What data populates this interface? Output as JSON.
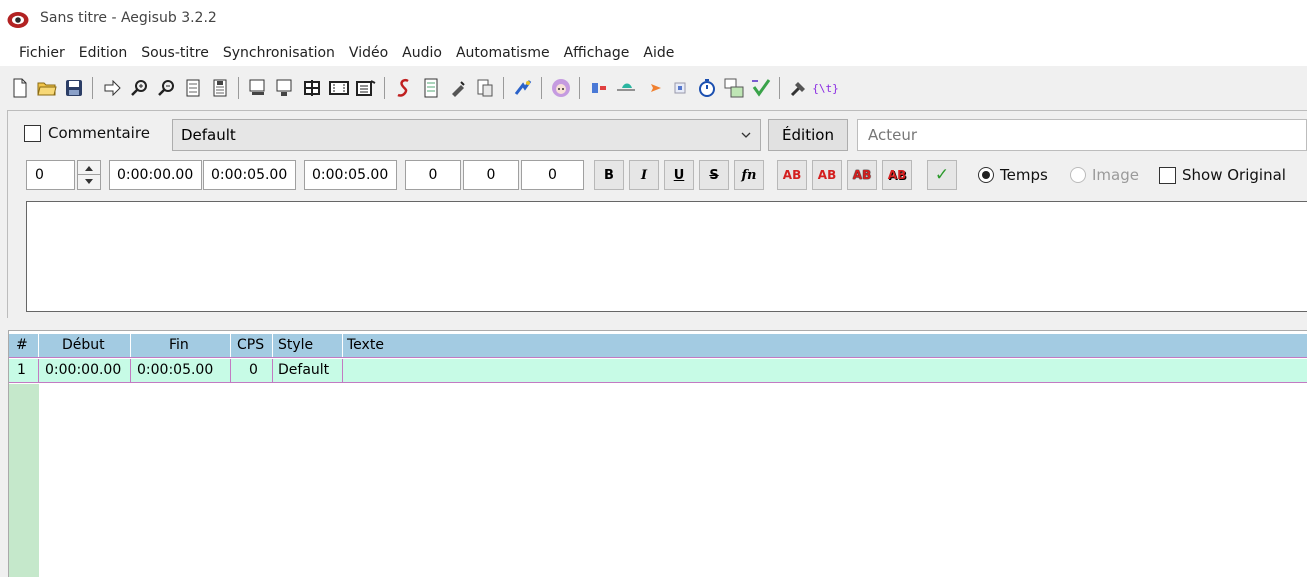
{
  "window": {
    "title": "Sans titre - Aegisub 3.2.2"
  },
  "menu": [
    "Fichier",
    "Edition",
    "Sous-titre",
    "Synchronisation",
    "Vidéo",
    "Audio",
    "Automatisme",
    "Affichage",
    "Aide"
  ],
  "toolbar": {
    "groups": [
      [
        "new-file-icon",
        "open-folder-icon",
        "save-icon"
      ],
      [
        "jump-to-icon",
        "zoom-in-icon",
        "zoom-out-icon",
        "snap-start-icon",
        "snap-end-icon"
      ],
      [
        "shift-times-icon",
        "shift-to-video-icon",
        "video-zoom-icon",
        "video-details-icon",
        "keyframes-icon"
      ],
      [
        "styles-manager-icon",
        "properties-icon",
        "attachments-icon",
        "fonts-collector-icon"
      ],
      [
        "automation-icon"
      ],
      [
        "assistant-icon"
      ],
      [
        "resample-icon",
        "timing-post-icon",
        "kanji-timer-icon",
        "select-lines-icon",
        "timer-icon",
        "translation-icon",
        "spellcheck-icon"
      ],
      [
        "options-icon",
        "tag-toggle-icon"
      ]
    ],
    "tag_toggle_label": "{\\t}"
  },
  "edit": {
    "comment_label": "Commentaire",
    "style_value": "Default",
    "edition_label": "Édition",
    "actor_placeholder": "Acteur",
    "layer": "0",
    "start_time": "0:00:00.00",
    "end_time": "0:00:05.00",
    "duration": "0:00:05.00",
    "margin_l": "0",
    "margin_r": "0",
    "margin_v": "0",
    "bold_label": "B",
    "italic_label": "I",
    "underline_label": "U",
    "strike_label": "S",
    "font_label": "fn",
    "color_labels": [
      "AB",
      "AB",
      "AB",
      "AB"
    ],
    "commit_label": "✓",
    "time_mode_label": "Temps",
    "frame_mode_label": "Image",
    "show_original_label": "Show Original",
    "text": ""
  },
  "grid": {
    "columns": [
      "#",
      "Début",
      "Fin",
      "CPS",
      "Style",
      "Texte"
    ],
    "rows": [
      {
        "num": "1",
        "start": "0:00:00.00",
        "end": "0:00:05.00",
        "cps": "0",
        "style": "Default",
        "text": ""
      }
    ]
  },
  "colors": {
    "grid_header": "#a3cbe2",
    "grid_row": "#c7fbe6",
    "grid_gutter": "#c5e8cb",
    "row_border": "#c27ac2"
  }
}
